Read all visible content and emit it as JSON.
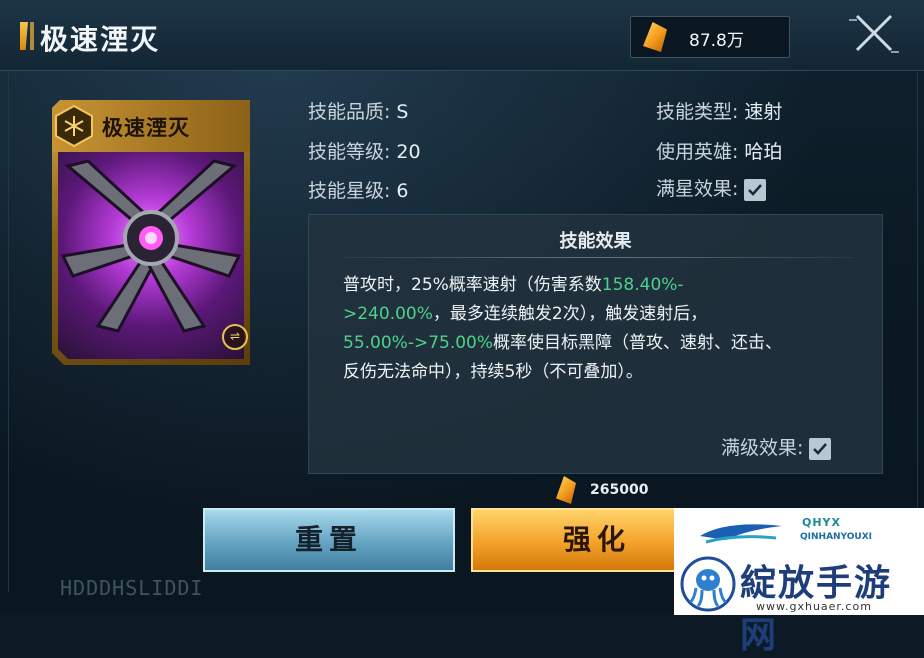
{
  "header": {
    "title": "极速湮灭",
    "currency_value": "87.8万"
  },
  "card": {
    "name": "极速湮灭",
    "corner_icon": "double-chevron-icon"
  },
  "info_left": [
    {
      "label": "技能品质:",
      "value": "S"
    },
    {
      "label": "技能等级:",
      "value": "20"
    },
    {
      "label": "技能星级:",
      "value": "6"
    }
  ],
  "info_right": [
    {
      "label": "技能类型:",
      "value": "速射"
    },
    {
      "label": "使用英雄:",
      "value": "哈珀"
    },
    {
      "label": "满星效果:",
      "checked": true
    }
  ],
  "effect": {
    "title": "技能效果",
    "line1_a": "普攻时，25%概率速射（伤害系数",
    "line1_b": "158.40%-",
    "line2_a": ">240.00%",
    "line2_b": "，最多连续触发2次），触发速射后，",
    "line3_a": "55.00%->75.00%",
    "line3_b": "概率使目标黑障（普攻、速射、还击、",
    "line4": "反伤无法命中），持续5秒（不可叠加）。",
    "max_level_label": "满级效果:",
    "max_level_checked": true
  },
  "cost": {
    "value": "265000"
  },
  "buttons": {
    "reset": "重置",
    "upgrade": "强化"
  },
  "footer_code": "HDDDHSLIDDI",
  "watermark": {
    "brand": "QHYX",
    "brand_sub": "QINHANYOUXI",
    "title": "綻放手游网",
    "url": "www.gxhuaer.com"
  },
  "colors": {
    "highlight": "#4fd18b",
    "gold": "#f3a22a",
    "blue_button": "#6aa8c6"
  }
}
